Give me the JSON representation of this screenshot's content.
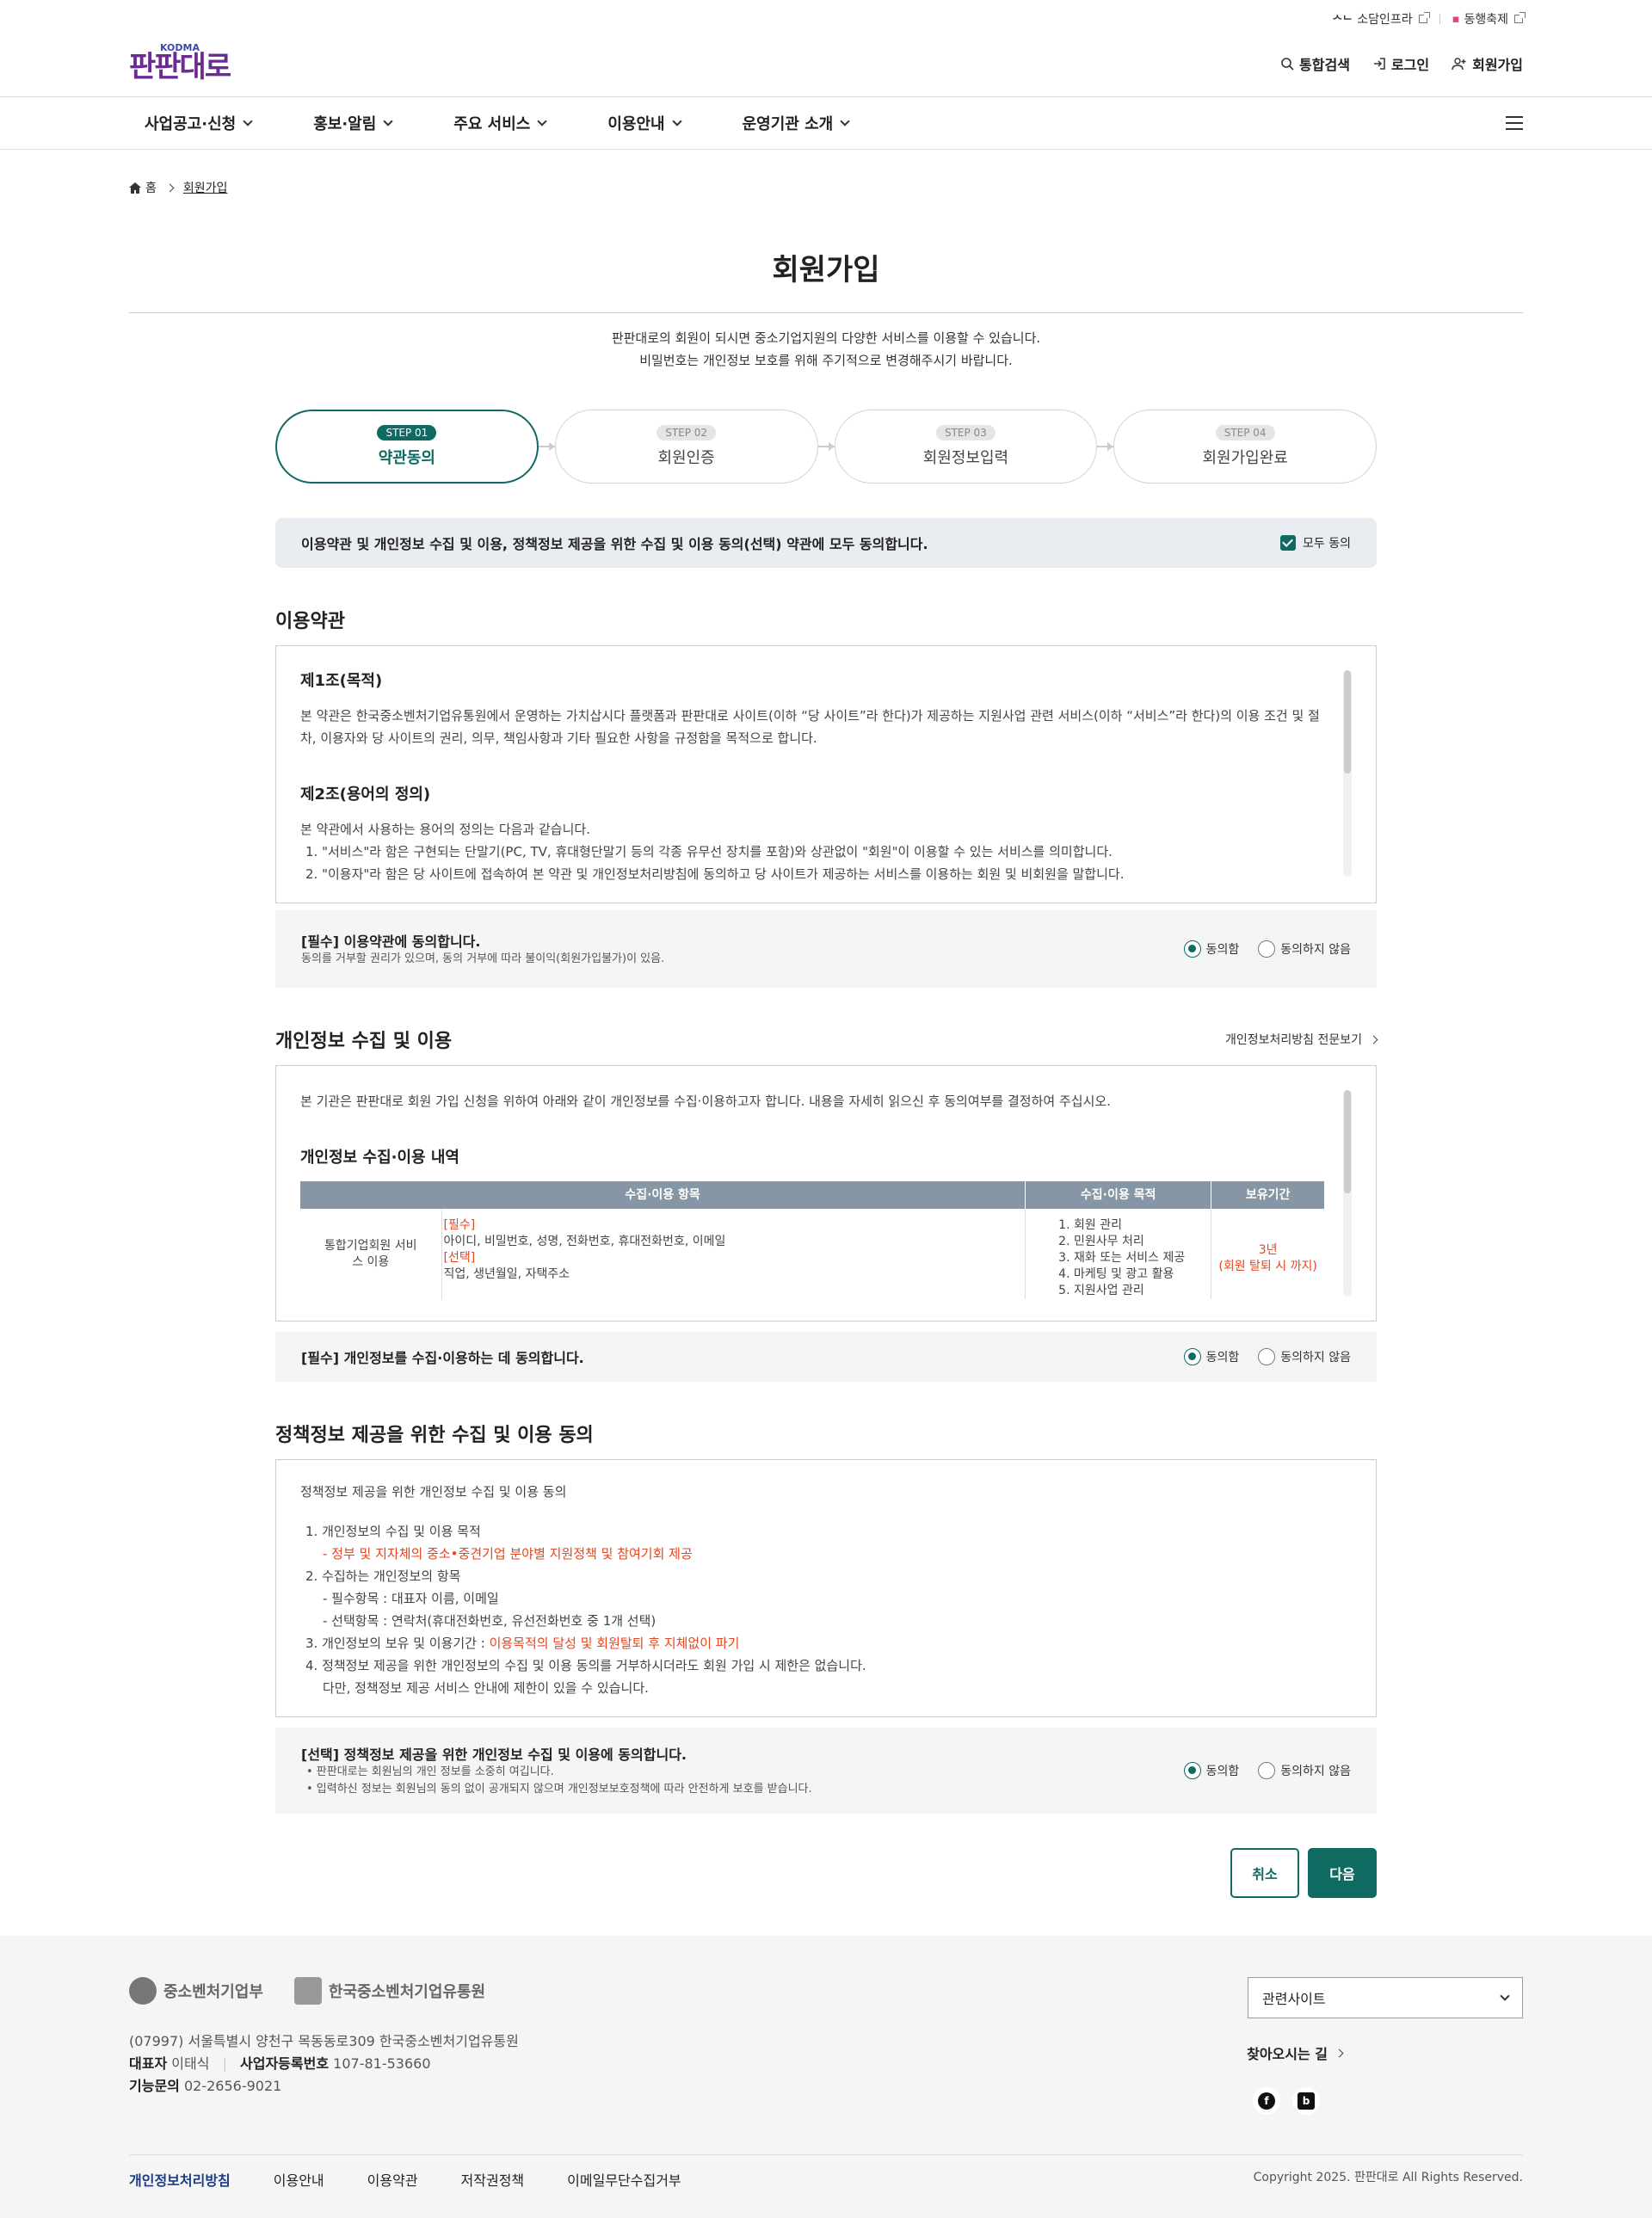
{
  "util": {
    "link1": "소담인프라",
    "link2": "동행축제"
  },
  "logo": {
    "sub": "KODMA",
    "name": "판판대로"
  },
  "header": {
    "search": "통합검색",
    "login": "로그인",
    "join": "회원가입"
  },
  "gnb": [
    "사업공고·신청",
    "홍보·알림",
    "주요 서비스",
    "이용안내",
    "운영기관 소개"
  ],
  "breadcrumb": {
    "home": "홈",
    "current": "회원가입"
  },
  "page": {
    "title": "회원가입",
    "intro1": "판판대로의 회원이 되시면 중소기업지원의 다양한 서비스를 이용할 수 있습니다.",
    "intro2": "비밀번호는 개인정보 보호를 위해 주기적으로 변경해주시기 바랍니다."
  },
  "steps": [
    {
      "badge": "STEP 01",
      "label": "약관동의"
    },
    {
      "badge": "STEP 02",
      "label": "회원인증"
    },
    {
      "badge": "STEP 03",
      "label": "회원정보입력"
    },
    {
      "badge": "STEP 04",
      "label": "회원가입완료"
    }
  ],
  "agreeAll": {
    "text": "이용약관 및 개인정보 수집 및 이용, 정책정보 제공을 위한 수집 및 이용 동의(선택) 약관에 모두 동의합니다.",
    "check": "모두 동의"
  },
  "terms": {
    "title": "이용약관",
    "a1": "제1조(목적)",
    "a1p": "본 약관은 한국중소벤처기업유통원에서 운영하는 가치삽시다 플랫폼과 판판대로 사이트(이하 “당 사이트”라 한다)가 제공하는 지원사업 관련 서비스(이하 “서비스”라 한다)의 이용 조건 및 절차, 이용자와 당 사이트의 권리, 의무, 책임사항과 기타 필요한 사항을 규정함을 목적으로 합니다.",
    "a2": "제2조(용어의 정의)",
    "a2p": "본 약관에서 사용하는 용어의 정의는 다음과 같습니다.",
    "a2l1": "1. \"서비스\"라 함은 구현되는 단말기(PC, TV, 휴대형단말기 등의 각종 유무선 장치를 포함)와 상관없이 \"회원\"이 이용할 수 있는 서비스를 의미합니다.",
    "a2l2": "2. \"이용자\"라 함은 당 사이트에 접속하여 본 약관 및 개인정보처리방침에 동의하고 당 사이트가 제공하는 서비스를 이용하는 회원 및 비회원을 말합니다.",
    "agree": "[필수] 이용약관에 동의합니다.",
    "desc": "동의를 거부할 권리가 있으며, 동의 거부에 따라 불이익(회원가입불가)이 있음."
  },
  "radio": {
    "yes": "동의함",
    "no": "동의하지 않음"
  },
  "privacy": {
    "title": "개인정보 수집 및 이용",
    "more": "개인정보처리방침 전문보기",
    "intro": "본 기관은 판판대로 회원 가입 신청을 위하여 아래와 같이 개인정보를 수집·이용하고자 합니다. 내용을 자세히 읽으신 후 동의여부를 결정하여 주십시오.",
    "sub": "개인정보 수집·이용 내역",
    "th": [
      "수집·이용 항목",
      "수집·이용 목적",
      "보유기간"
    ],
    "rowHead": "통합기업회원 서비스 이용",
    "req": "[필수]",
    "reqItems": "아이디, 비밀번호, 성명, 전화번호, 휴대전화번호, 이메일",
    "opt": "[선택]",
    "optItems": "직업, 생년월일, 자택주소",
    "purposes": [
      "1. 회원 관리",
      "2. 민원사무 처리",
      "3. 재화 또는 서비스 제공",
      "4. 마케팅 및 광고 활용",
      "5. 지원사업 관리"
    ],
    "keep1": "3년",
    "keep2": "(회원 탈퇴 시 까지)",
    "agree": "[필수] 개인정보를 수집·이용하는 데 동의합니다."
  },
  "policy": {
    "title": "정책정보 제공을 위한 수집 및 이용 동의",
    "intro": "정책정보 제공을 위한 개인정보 수집 및 이용 동의",
    "l1": "1. 개인정보의 수집 및 이용 목적",
    "l1a": "- 정부 및 지자체의 중소•중견기업 분야별 지원정책 및 참여기회 제공",
    "l2": "2. 수집하는 개인정보의 항목",
    "l2a": "- 필수항목 : 대표자 이름, 이메일",
    "l2b": "- 선택항목 : 연락처(휴대전화번호, 유선전화번호 중 1개 선택)",
    "l3": "3. 개인정보의 보유 및 이용기간 : ",
    "l3r": "이용목적의 달성 및 회원탈퇴 후 지체없이 파기",
    "l4": "4. 정책정보 제공을 위한 개인정보의 수집 및 이용 동의를 거부하시더라도 회원 가입 시 제한은 없습니다.",
    "l4b": "다만, 정책정보 제공 서비스 안내에 제한이 있을 수 있습니다.",
    "agree": "[선택] 정책정보 제공을 위한 개인정보 수집 및 이용에 동의합니다.",
    "d1": "• 판판대로는 회원님의 개인 정보를 소중히 여깁니다.",
    "d2": "• 입력하신 정보는 회원님의 동의 없이 공개되지 않으며 개인정보보호정책에 따라 안전하게 보호를 받습니다."
  },
  "buttons": {
    "cancel": "취소",
    "next": "다음"
  },
  "footer": {
    "org1": "중소벤처기업부",
    "org2": "한국중소벤처기업유통원",
    "address": "(07997) 서울특별시 양천구 목동동로309 한국중소벤처기업유통원",
    "ceoLabel": "대표자",
    "ceo": "이태식",
    "bizLabel": "사업자등록번호",
    "biz": "107-81-53660",
    "telLabel": "기능문의",
    "tel": "02-2656-9021",
    "related": "관련사이트",
    "way": "찾아오시는 길",
    "nav": [
      "개인정보처리방침",
      "이용안내",
      "이용약관",
      "저작권정책",
      "이메일무단수집거부"
    ],
    "copy": "Copyright 2025. 판판대로 All Rights Reserved."
  }
}
